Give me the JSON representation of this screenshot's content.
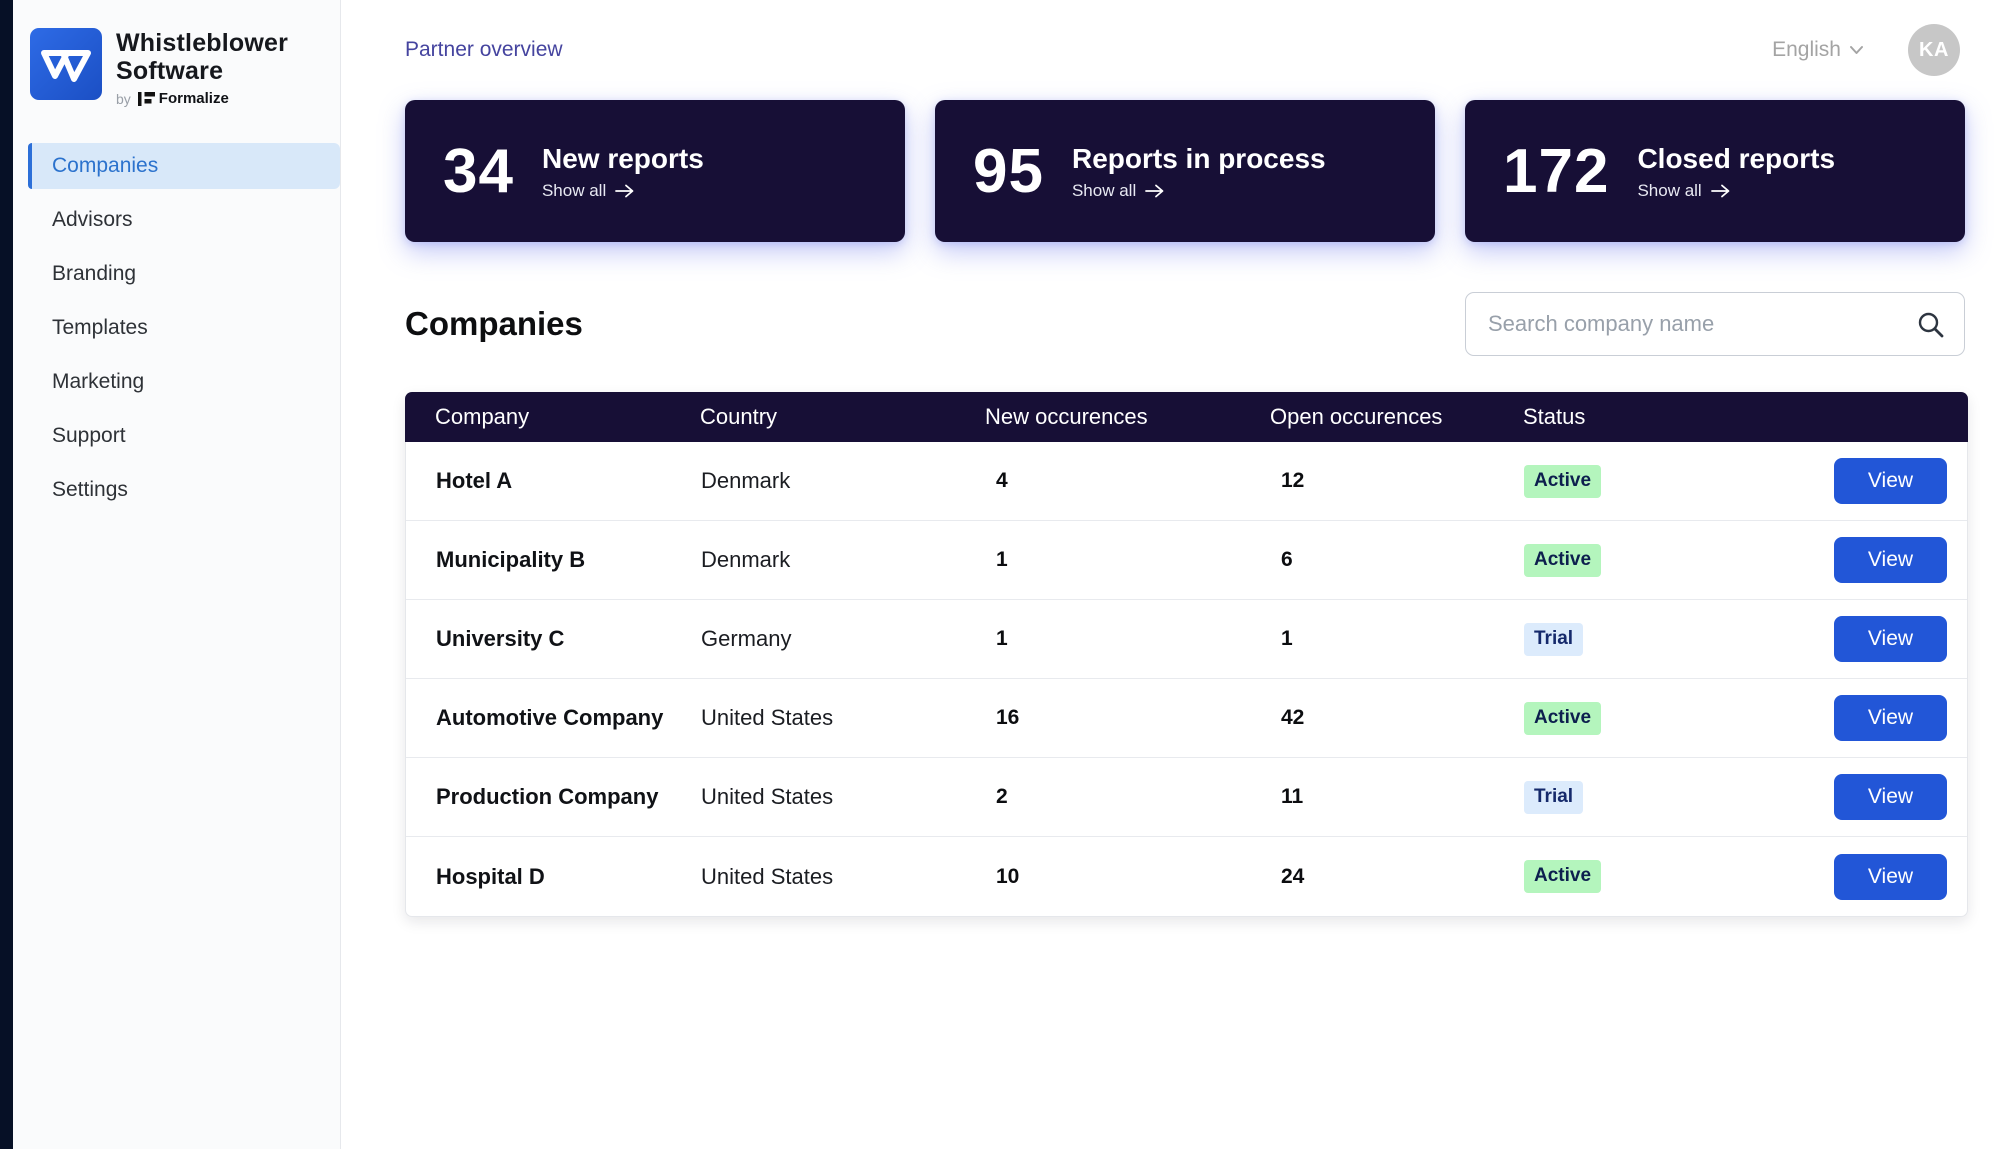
{
  "brand": {
    "name_line1": "Whistleblower",
    "name_line2": "Software",
    "byline_prefix": "by",
    "byline_brand": "Formalize"
  },
  "topbar": {
    "breadcrumb": "Partner overview",
    "language": "English",
    "avatar_initials": "KA"
  },
  "sidebar": {
    "items": [
      {
        "label": "Companies",
        "active": true
      },
      {
        "label": "Advisors",
        "active": false
      },
      {
        "label": "Branding",
        "active": false
      },
      {
        "label": "Templates",
        "active": false
      },
      {
        "label": "Marketing",
        "active": false
      },
      {
        "label": "Support",
        "active": false
      },
      {
        "label": "Settings",
        "active": false
      }
    ]
  },
  "stats": [
    {
      "value": "34",
      "label": "New reports",
      "link_label": "Show all"
    },
    {
      "value": "95",
      "label": "Reports in process",
      "link_label": "Show all"
    },
    {
      "value": "172",
      "label": "Closed reports",
      "link_label": "Show all"
    }
  ],
  "companies_section": {
    "title": "Companies",
    "search_placeholder": "Search company name"
  },
  "table": {
    "columns": {
      "company": "Company",
      "country": "Country",
      "new": "New occurences",
      "open": "Open occurences",
      "status": "Status"
    },
    "action_label": "View",
    "rows": [
      {
        "company": "Hotel A",
        "country": "Denmark",
        "new": "4",
        "open": "12",
        "status": "Active",
        "badge_class": "badge badge--active"
      },
      {
        "company": "Municipality B",
        "country": "Denmark",
        "new": "1",
        "open": "6",
        "status": "Active",
        "badge_class": "badge badge--active"
      },
      {
        "company": "University C",
        "country": "Germany",
        "new": "1",
        "open": "1",
        "status": "Trial",
        "badge_class": "badge badge--trial"
      },
      {
        "company": "Automotive Company",
        "country": "United States",
        "new": "16",
        "open": "42",
        "status": "Active",
        "badge_class": "badge badge--active"
      },
      {
        "company": "Production Company",
        "country": "United States",
        "new": "2",
        "open": "11",
        "status": "Trial",
        "badge_class": "badge badge--trial"
      },
      {
        "company": "Hospital D",
        "country": "United States",
        "new": "10",
        "open": "24",
        "status": "Active",
        "badge_class": "badge badge--active"
      }
    ]
  },
  "colors": {
    "dark_navy": "#170f36",
    "edge_strip": "#061026",
    "primary_blue": "#2256d7",
    "active_badge_bg": "#b4f5bd",
    "trial_badge_bg": "#dcebfc",
    "active_nav_bg": "#d8e8f9",
    "breadcrumb_indigo": "#45449f"
  }
}
